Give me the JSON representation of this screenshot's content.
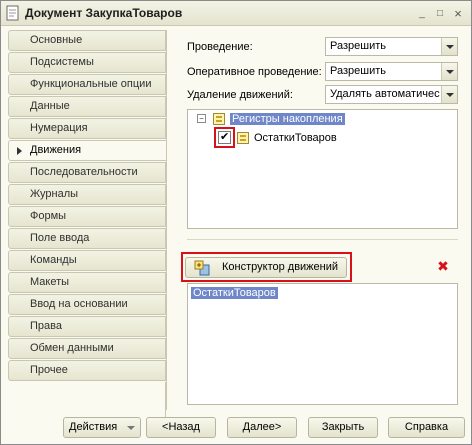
{
  "window": {
    "title": "Документ ЗакупкаТоваров",
    "controls": {
      "minimize": "_",
      "maximize": "□",
      "close": "×"
    }
  },
  "nav": {
    "items": [
      {
        "label": "Основные"
      },
      {
        "label": "Подсистемы"
      },
      {
        "label": "Функциональные опции"
      },
      {
        "label": "Данные"
      },
      {
        "label": "Нумерация"
      },
      {
        "label": "Движения",
        "active": true
      },
      {
        "label": "Последовательности"
      },
      {
        "label": "Журналы"
      },
      {
        "label": "Формы"
      },
      {
        "label": "Поле ввода"
      },
      {
        "label": "Команды"
      },
      {
        "label": "Макеты"
      },
      {
        "label": "Ввод на основании"
      },
      {
        "label": "Права"
      },
      {
        "label": "Обмен данными"
      },
      {
        "label": "Прочее"
      }
    ]
  },
  "fields": {
    "posting": {
      "label": "Проведение:",
      "value": "Разрешить"
    },
    "realtime_posting": {
      "label": "Оперативное проведение:",
      "value": "Разрешить"
    },
    "delete_movements": {
      "label": "Удаление движений:",
      "value": "Удалять автоматически"
    }
  },
  "tree": {
    "root_label": "Регистры накопления",
    "child_label": "ОстаткиТоваров",
    "child_checked": true
  },
  "movements": {
    "constructor_label": "Конструктор движений",
    "code_text": "ОстаткиТоваров"
  },
  "buttons": {
    "actions": "Действия",
    "back": "<Назад",
    "next": "Далее>",
    "close": "Закрыть",
    "help": "Справка"
  },
  "colors": {
    "highlight": "#d8101a",
    "selection": "#6f86c8",
    "window_bg": "#fafaf0"
  }
}
